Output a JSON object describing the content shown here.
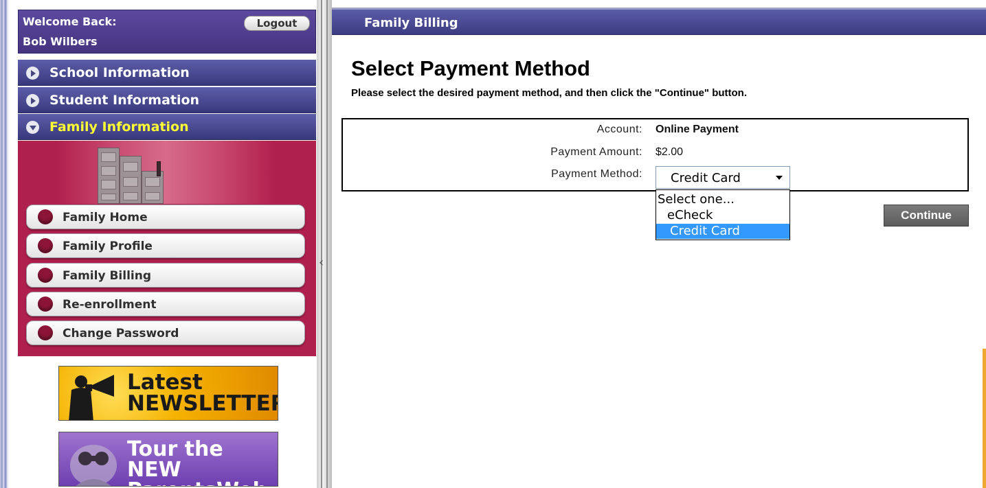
{
  "user": {
    "welcome_label": "Welcome Back:",
    "name": "Bob Wilbers",
    "logout_label": "Logout"
  },
  "sidebar": {
    "sections": [
      {
        "label": "School Information",
        "expanded": false
      },
      {
        "label": "Student Information",
        "expanded": false
      },
      {
        "label": "Family Information",
        "expanded": true
      }
    ],
    "family_menu": [
      {
        "label": "Family Home"
      },
      {
        "label": "Family Profile"
      },
      {
        "label": "Family Billing"
      },
      {
        "label": "Re-enrollment"
      },
      {
        "label": "Change Password"
      }
    ],
    "promos": {
      "newsletter": {
        "line1": "Latest",
        "line2": "NEWSLETTER"
      },
      "tour": {
        "line1": "Tour the NEW",
        "line2": "ParentsWeb"
      }
    }
  },
  "main": {
    "header_title": "Family Billing",
    "page_title": "Select Payment Method",
    "instructions": "Please select the desired payment method, and then click the \"Continue\" button.",
    "form": {
      "account_label": "Account:",
      "account_value": "Online Payment",
      "amount_label": "Payment Amount:",
      "amount_value": "$2.00",
      "method_label": "Payment Method:",
      "method_selected": "Credit Card",
      "method_options": [
        "Select one...",
        "eCheck",
        "Credit Card"
      ]
    },
    "continue_label": "Continue"
  },
  "colors": {
    "nav_blue": "#45467f",
    "active_label": "#ffff33",
    "family_panel": "#b0204e",
    "selected_option": "#3399ff",
    "continue_button": "#6b6b6b"
  }
}
